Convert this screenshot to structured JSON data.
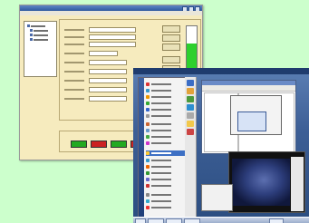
{
  "background_color": "#ccffcc",
  "server_tool": {
    "title_bar_color": "#2f5aa0",
    "body_color": "#f6ebbe",
    "gauge": {
      "level_percent": 62,
      "fill_color": "#2dd02d"
    },
    "status_buttons": [
      {
        "icon": "green-status-button",
        "color": "#22aa22"
      },
      {
        "icon": "red-status-button",
        "color": "#cc2222"
      },
      {
        "icon": "green-status-button",
        "color": "#22aa22"
      },
      {
        "icon": "red-status-button",
        "color": "#cc2222"
      }
    ]
  },
  "desktop": {
    "menu_highlight_color": "#3c6fc4",
    "taskbar_color": "#96a8c8"
  }
}
